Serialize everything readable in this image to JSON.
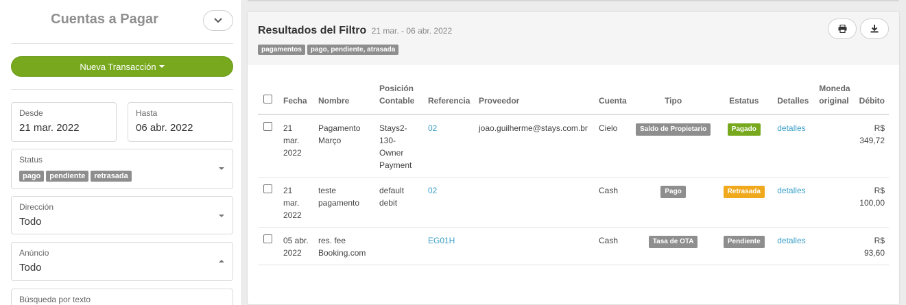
{
  "sidebar": {
    "title": "Cuentas a Pagar",
    "new_transaction_label": "Nueva Transacción",
    "from": {
      "label": "Desde",
      "value": "21 mar. 2022"
    },
    "to": {
      "label": "Hasta",
      "value": "06 abr. 2022"
    },
    "status": {
      "label": "Status",
      "chips": [
        "pago",
        "pendiente",
        "retrasada"
      ]
    },
    "direction": {
      "label": "Dirección",
      "value": "Todo"
    },
    "listing": {
      "label": "Anúncio",
      "value": "Todo"
    },
    "text_search": {
      "label": "Búsqueda por texto"
    }
  },
  "results": {
    "title": "Resultados del Filtro",
    "range": "21 mar. - 06 abr. 2022",
    "tags": [
      "pagamentos",
      "pago, pendiente, atrasada"
    ],
    "print_icon": "printer-icon",
    "download_icon": "download-icon",
    "columns": [
      "Fecha",
      "Nombre",
      "Posición Contable",
      "Referencia",
      "Proveedor",
      "Cuenta",
      "Tipo",
      "Estatus",
      "Detalles",
      "Moneda original",
      "Débito"
    ],
    "rows": [
      {
        "fecha": "21 mar. 2022",
        "nombre": "Pagamento Março",
        "posicion": "Stays2-130-Owner Payment",
        "referencia": "02",
        "proveedor": "joao.guilherme@stays.com.br",
        "cuenta": "Cielo",
        "tipo": "Saldo de Propietario",
        "estatus": "Pagado",
        "estatus_color": "#77a81e",
        "detalles": "detalles",
        "moneda": "",
        "debito": "R$ 349,72"
      },
      {
        "fecha": "21 mar. 2022",
        "nombre": "teste pagamento",
        "posicion": "default debit",
        "referencia": "02",
        "proveedor": "",
        "cuenta": "Cash",
        "tipo": "Pago",
        "estatus": "Retrasada",
        "estatus_color": "#f0a81c",
        "detalles": "detalles",
        "moneda": "",
        "debito": "R$ 100,00"
      },
      {
        "fecha": "05 abr. 2022",
        "nombre": "res. fee Booking.com",
        "posicion": "",
        "referencia": "EG01H",
        "proveedor": "",
        "cuenta": "Cash",
        "tipo": "Tasa de OTA",
        "estatus": "Pendiente",
        "estatus_color": "#8e8e8e",
        "detalles": "detalles",
        "moneda": "",
        "debito": "R$ 93,60"
      }
    ]
  },
  "colors": {
    "accent_green": "#77a81e",
    "link": "#3a9fc7",
    "warning": "#f0a81c",
    "chip_gray": "#8e8e8e"
  }
}
